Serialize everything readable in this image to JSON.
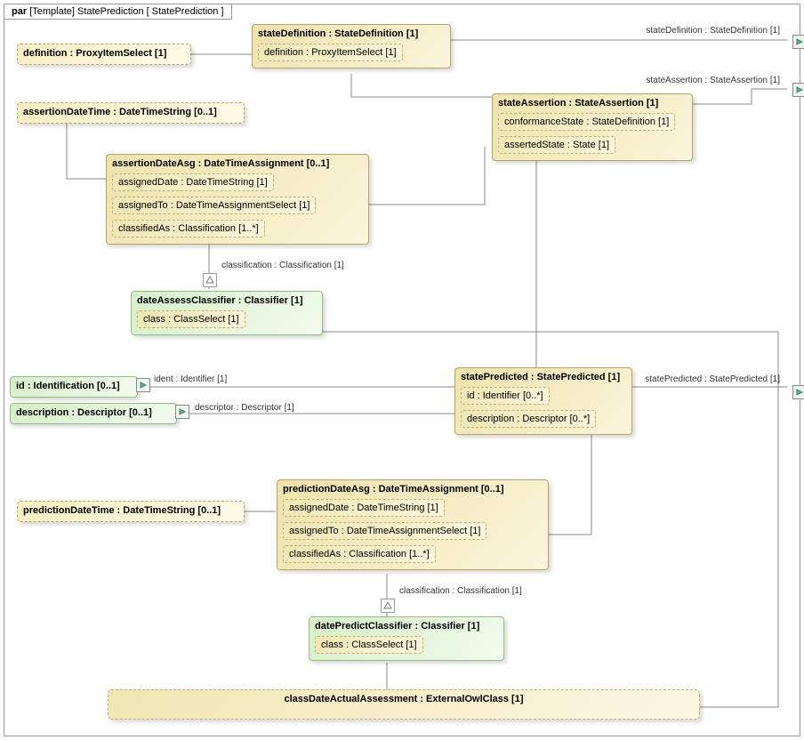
{
  "frame": {
    "header_prefix": "par",
    "header_kind": "[Template]",
    "header_name": "StatePrediction",
    "header_bracket": "[ StatePrediction ]"
  },
  "labels": {
    "classification1": "classification : Classification [1]",
    "classification2": "classification : Classification [1]",
    "ident": "ident : Identifier [1]",
    "descriptor": "descriptor : Descriptor [1]"
  },
  "ports": {
    "stateDefinition": "stateDefinition : StateDefinition [1]",
    "stateAssertion": "stateAssertion : StateAssertion [1]",
    "statePredicted": "statePredicted : StatePredicted [1]"
  },
  "blocks": {
    "definition": "definition : ProxyItemSelect [1]",
    "stateDefinition": {
      "title": "stateDefinition : StateDefinition [1]",
      "definition": "definition : ProxyItemSelect [1]"
    },
    "assertionDateTime": "assertionDateTime : DateTimeString [0..1]",
    "stateAssertion": {
      "title": "stateAssertion : StateAssertion [1]",
      "conformanceState": "conformanceState : StateDefinition [1]",
      "assertedState": "assertedState : State [1]"
    },
    "assertionDateAsg": {
      "title": "assertionDateAsg : DateTimeAssignment [0..1]",
      "assignedDate": "assignedDate : DateTimeString [1]",
      "assignedTo": "assignedTo : DateTimeAssignmentSelect [1]",
      "classifiedAs": "classifiedAs : Classification [1..*]"
    },
    "dateAssessClassifier": {
      "title": "dateAssessClassifier : Classifier [1]",
      "class": "class : ClassSelect [1]"
    },
    "id": "id : Identification [0..1]",
    "description": "description : Descriptor [0..1]",
    "statePredicted": {
      "title": "statePredicted : StatePredicted [1]",
      "id": "id : Identifier [0..*]",
      "description": "description : Descriptor [0..*]"
    },
    "predictionDateTime": "predictionDateTime : DateTimeString [0..1]",
    "predictionDateAsg": {
      "title": "predictionDateAsg : DateTimeAssignment [0..1]",
      "assignedDate": "assignedDate : DateTimeString [1]",
      "assignedTo": "assignedTo : DateTimeAssignmentSelect [1]",
      "classifiedAs": "classifiedAs : Classification [1..*]"
    },
    "datePredictClassifier": {
      "title": "datePredictClassifier : Classifier [1]",
      "class": "class : ClassSelect [1]"
    },
    "classDateActualAssessment": "classDateActualAssessment : ExternalOwlClass [1]"
  }
}
